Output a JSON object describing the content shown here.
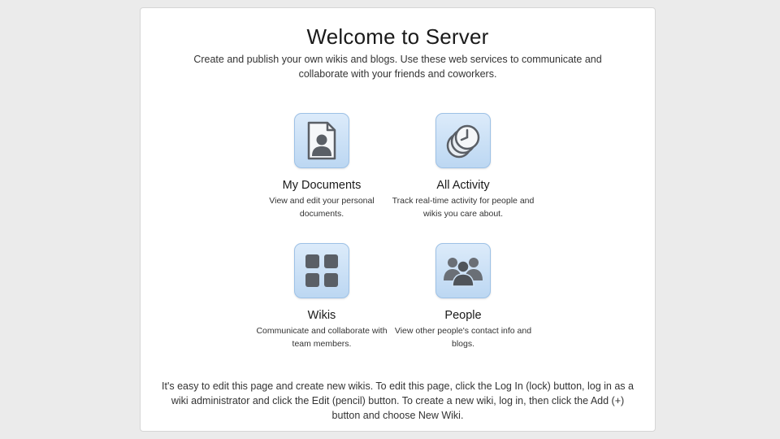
{
  "header": {
    "title": "Welcome to Server",
    "subtitle": "Create and publish your own wikis and blogs. Use these web services to communicate and collaborate with your friends and coworkers."
  },
  "tiles": [
    {
      "title": "My Documents",
      "description": "View and edit your personal documents.",
      "icon": "document-person-icon"
    },
    {
      "title": "All Activity",
      "description": "Track real-time activity for people and wikis you care about.",
      "icon": "activity-clock-icon"
    },
    {
      "title": "Wikis",
      "description": "Communicate and collaborate with team members.",
      "icon": "wiki-grid-icon"
    },
    {
      "title": "People",
      "description": "View other people's contact info and blogs.",
      "icon": "people-group-icon"
    }
  ],
  "footer": {
    "text": "It's easy to edit this page and create new wikis. To edit this page, click the Log In (lock) button, log in as a wiki administrator and click the Edit (pencil) button. To create a new wiki, log in, then click the Add (+) button and choose New Wiki."
  },
  "colors": {
    "background": "#ebebeb",
    "panel": "#ffffff",
    "icon_tile": "#cfe3f7",
    "icon_border": "#9dc1e6",
    "glyph": "#5a5f66"
  }
}
